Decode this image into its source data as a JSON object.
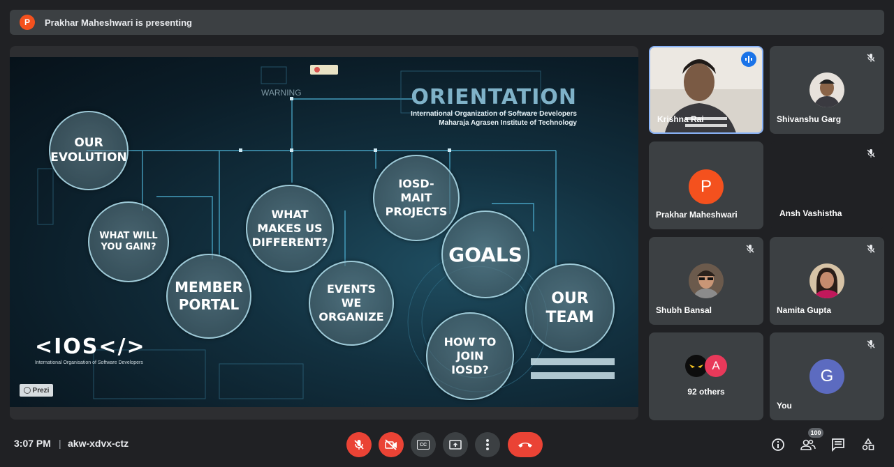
{
  "banner": {
    "presenter_initial": "P",
    "text": "Prakhar Maheshwari is presenting"
  },
  "slide": {
    "title": "ORIENTATION",
    "subtitle1": "International Organization of Software Developers",
    "subtitle2": "Maharaja Agrasen Institute of Technology",
    "warning": "WARNING",
    "logo_text": "<IOS</>",
    "logo_sub": "International Organisation of Software Developers",
    "prezi": "Prezi",
    "bubbles": [
      "OUR EVOLUTION",
      "WHAT WILL YOU GAIN?",
      "MEMBER PORTAL",
      "WHAT MAKES US DIFFERENT?",
      "EVENTS WE ORGANIZE",
      "IOSD-MAIT PROJECTS",
      "GOALS",
      "HOW TO JOIN IOSD?",
      "OUR TEAM"
    ]
  },
  "participants": {
    "krishna": {
      "name": "Krishna Rai"
    },
    "shivanshu": {
      "name": "Shivanshu Garg"
    },
    "prakhar": {
      "name": "Prakhar Maheshwari",
      "initial": "P",
      "color": "#f4511e"
    },
    "ansh": {
      "name": "Ansh Vashistha"
    },
    "shubh": {
      "name": "Shubh Bansal"
    },
    "namita": {
      "name": "Namita Gupta"
    },
    "others": {
      "label": "92 others",
      "initial": "A",
      "color": "#e8395a"
    },
    "you": {
      "name": "You",
      "initial": "G",
      "color": "#5c6bc0"
    }
  },
  "bottom": {
    "time": "3:07 PM",
    "separator": "|",
    "meeting_code": "akw-xdvx-ctz",
    "participant_count": "100",
    "cc_label": "CC"
  },
  "colors": {
    "end_call": "#ea4335",
    "mic_off": "#ea4335",
    "accent_blue": "#8ab4f8"
  }
}
